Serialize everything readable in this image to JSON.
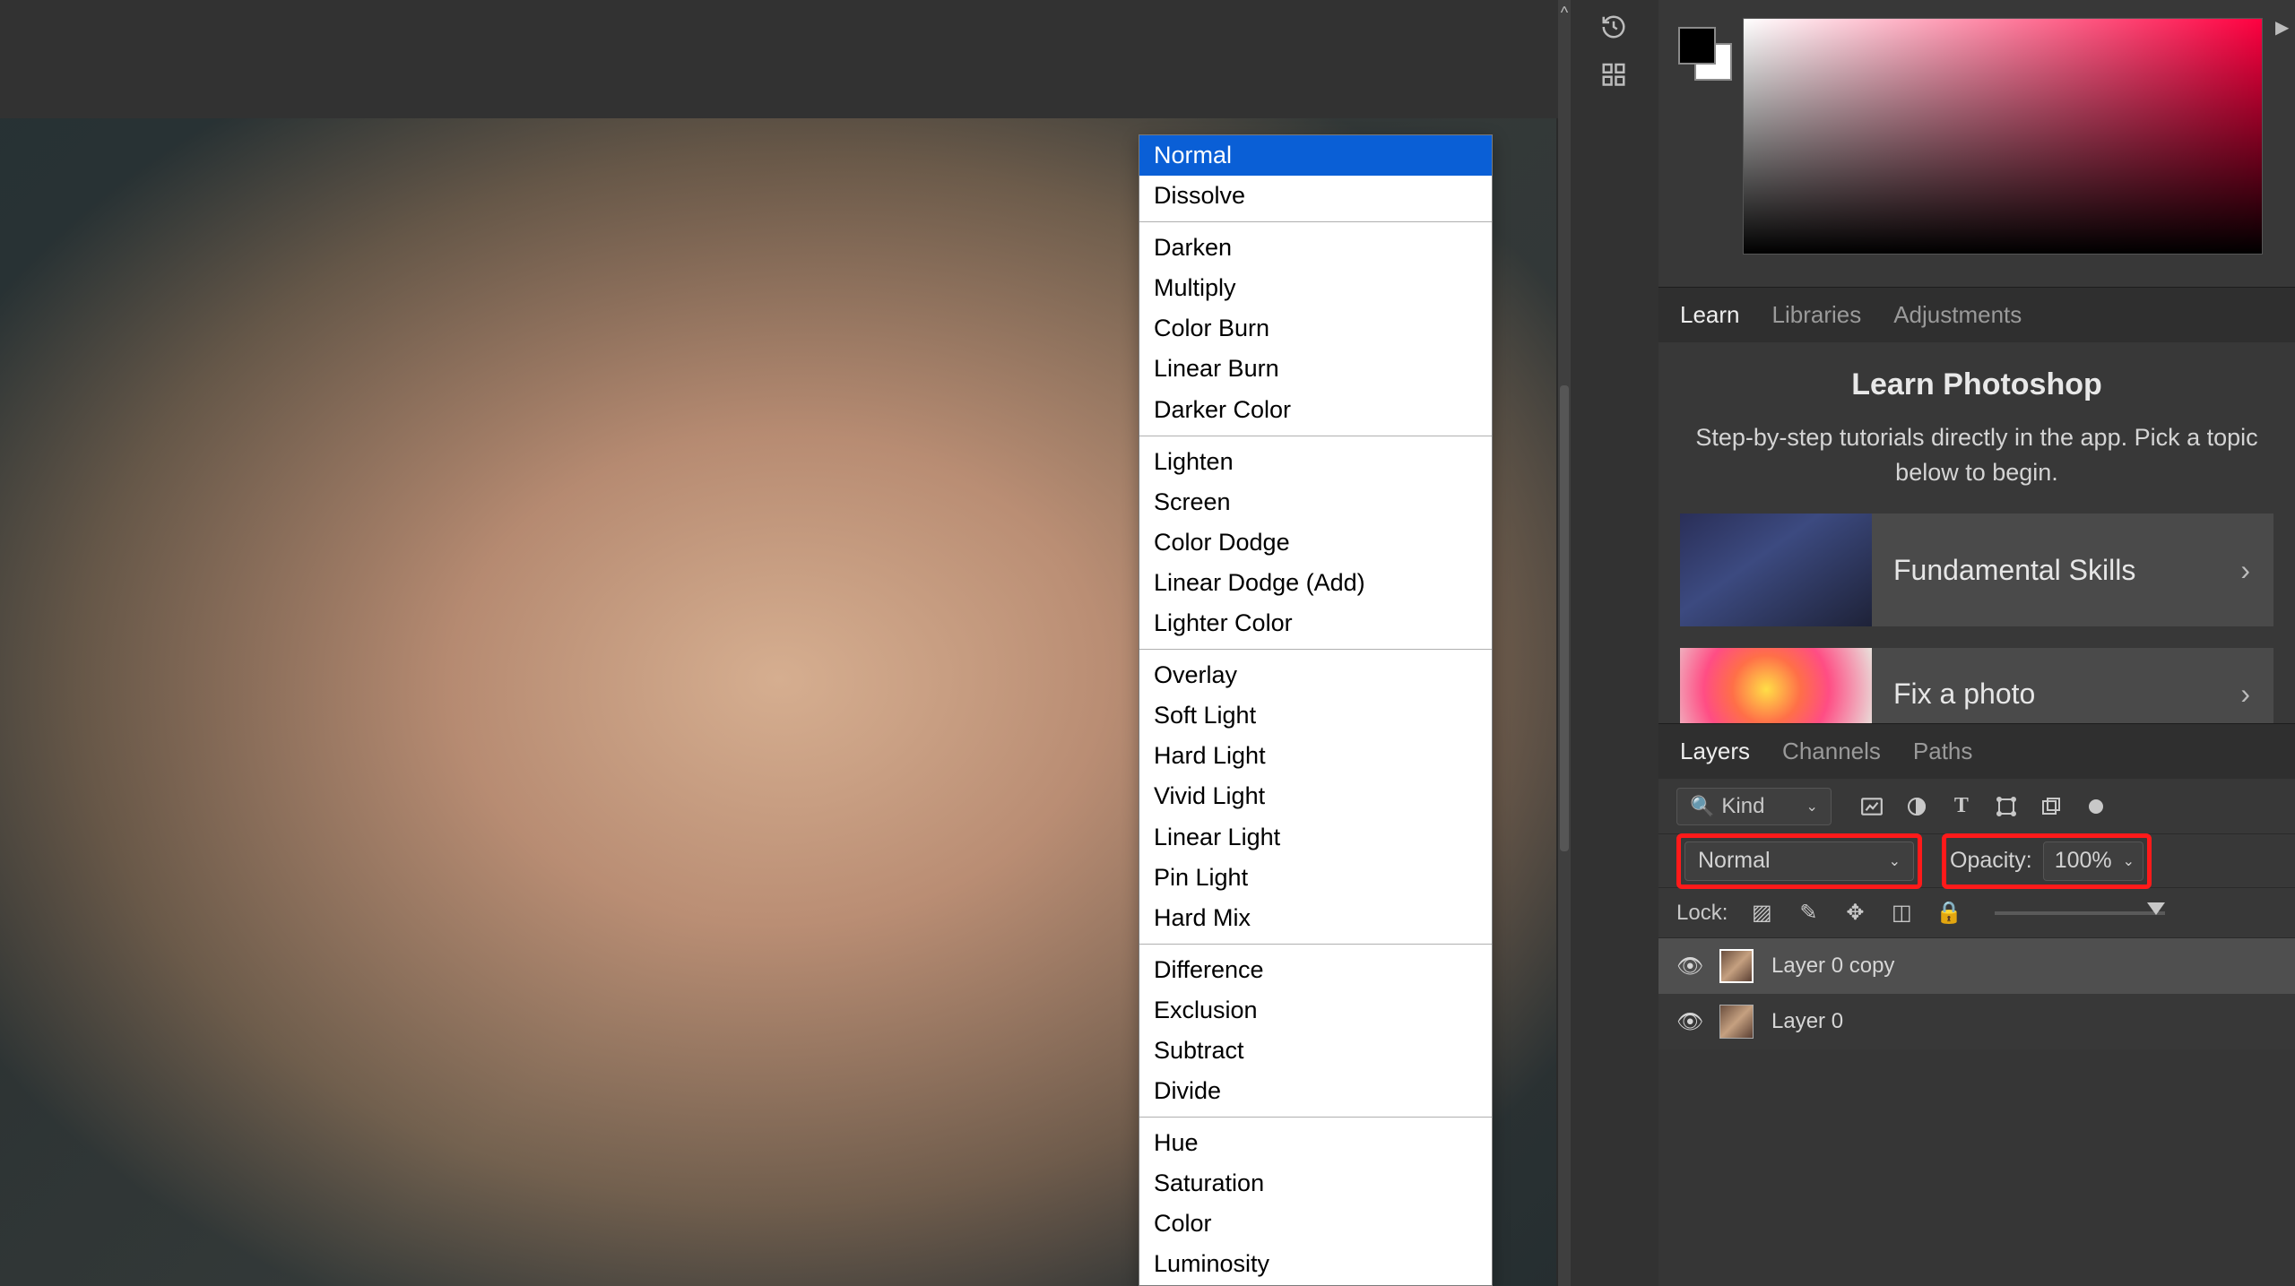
{
  "color_panel": {
    "hue_indicator": "▶"
  },
  "tabs_learn": {
    "labels": [
      "Learn",
      "Libraries",
      "Adjustments"
    ],
    "active": 0
  },
  "learn": {
    "title": "Learn Photoshop",
    "subtitle": "Step-by-step tutorials directly in the app. Pick a topic below to begin.",
    "cards": [
      {
        "label": "Fundamental Skills"
      },
      {
        "label": "Fix a photo"
      }
    ]
  },
  "tabs_layers": {
    "labels": [
      "Layers",
      "Channels",
      "Paths"
    ],
    "active": 0
  },
  "layers": {
    "kind_filter": "Kind",
    "blend_mode": "Normal",
    "opacity_label": "Opacity:",
    "opacity_value": "100%",
    "lock_label": "Lock:",
    "items": [
      {
        "name": "Layer 0 copy",
        "selected": true
      },
      {
        "name": "Layer 0",
        "selected": false
      }
    ]
  },
  "blend_modes": {
    "groups": [
      [
        "Normal",
        "Dissolve"
      ],
      [
        "Darken",
        "Multiply",
        "Color Burn",
        "Linear Burn",
        "Darker Color"
      ],
      [
        "Lighten",
        "Screen",
        "Color Dodge",
        "Linear Dodge (Add)",
        "Lighter Color"
      ],
      [
        "Overlay",
        "Soft Light",
        "Hard Light",
        "Vivid Light",
        "Linear Light",
        "Pin Light",
        "Hard Mix"
      ],
      [
        "Difference",
        "Exclusion",
        "Subtract",
        "Divide"
      ],
      [
        "Hue",
        "Saturation",
        "Color",
        "Luminosity"
      ]
    ],
    "selected": "Normal"
  }
}
